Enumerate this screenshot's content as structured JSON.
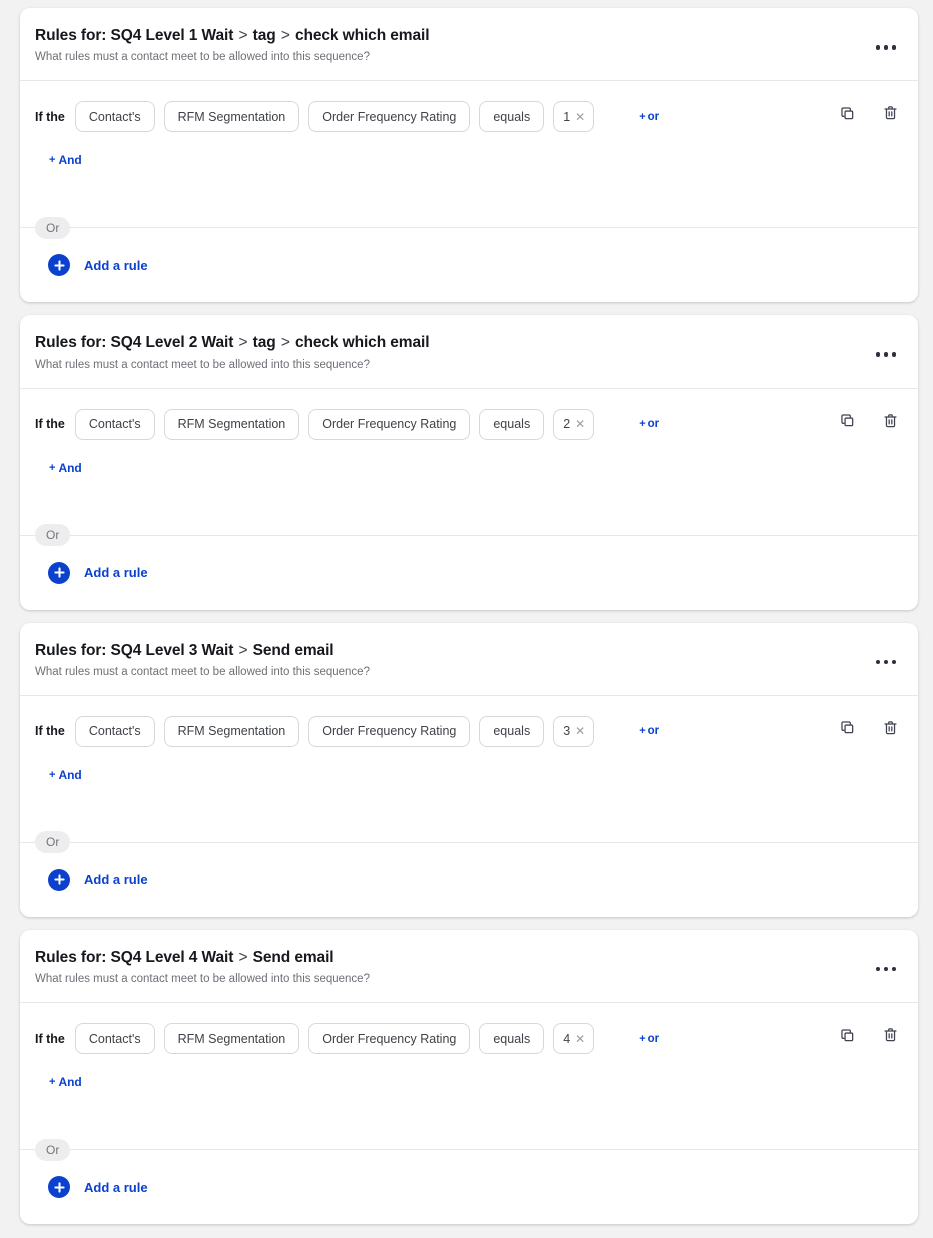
{
  "page": {
    "background": "#f2f2f3",
    "accent": "#0b41cd"
  },
  "labels": {
    "if_the": "If the",
    "or_link": "or",
    "and_link": "And",
    "or_pill": "Or",
    "add_rule": "Add a rule",
    "plus": "+",
    "remove_value": "✕",
    "subtitle": "What rules must a contact meet to be allowed into this sequence?",
    "title_prefix": "Rules for:",
    "separator": ">"
  },
  "icons": {
    "kebab": "more-horizontal-icon",
    "duplicate": "duplicate-icon",
    "delete": "trash-icon",
    "add": "plus-circle-icon"
  },
  "cards": [
    {
      "title_prefix": "Rules for:",
      "segments": [
        "SQ4 Level 1 Wait",
        "tag",
        "check which email"
      ],
      "subtitle": "What rules must a contact meet to be allowed into this sequence?",
      "rule": {
        "if_the": "If the",
        "subject": "Contact's",
        "field": "RFM Segmentation",
        "attribute": "Order Frequency Rating",
        "operator": "equals",
        "value": "1",
        "or_link": "or",
        "and_link": "And"
      }
    },
    {
      "title_prefix": "Rules for:",
      "segments": [
        "SQ4 Level 2 Wait",
        "tag",
        "check which email"
      ],
      "subtitle": "What rules must a contact meet to be allowed into this sequence?",
      "rule": {
        "if_the": "If the",
        "subject": "Contact's",
        "field": "RFM Segmentation",
        "attribute": "Order Frequency Rating",
        "operator": "equals",
        "value": "2",
        "or_link": "or",
        "and_link": "And"
      }
    },
    {
      "title_prefix": "Rules for:",
      "segments": [
        "SQ4 Level 3 Wait",
        "Send email"
      ],
      "subtitle": "What rules must a contact meet to be allowed into this sequence?",
      "rule": {
        "if_the": "If the",
        "subject": "Contact's",
        "field": "RFM Segmentation",
        "attribute": "Order Frequency Rating",
        "operator": "equals",
        "value": "3",
        "or_link": "or",
        "and_link": "And"
      }
    },
    {
      "title_prefix": "Rules for:",
      "segments": [
        "SQ4 Level 4 Wait",
        "Send email"
      ],
      "subtitle": "What rules must a contact meet to be allowed into this sequence?",
      "rule": {
        "if_the": "If the",
        "subject": "Contact's",
        "field": "RFM Segmentation",
        "attribute": "Order Frequency Rating",
        "operator": "equals",
        "value": "4",
        "or_link": "or",
        "and_link": "And"
      }
    }
  ]
}
